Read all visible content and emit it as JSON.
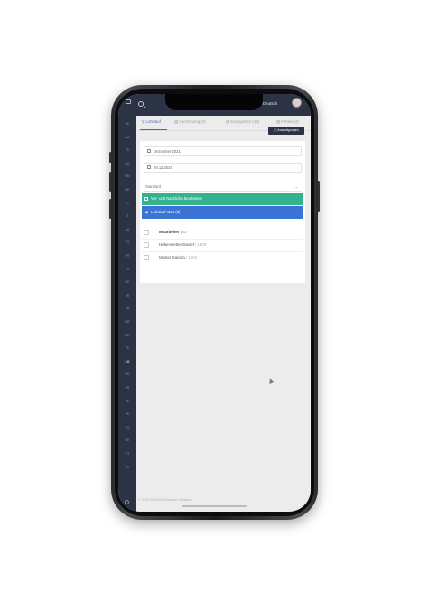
{
  "topbar": {
    "language": "Deutsch",
    "icons": [
      "logo-icon",
      "search-icon",
      "avatar"
    ]
  },
  "sidebar": {
    "items": [
      "DE",
      "MA",
      "TE",
      "KO",
      "UM",
      "NE",
      "VI",
      "IT",
      "AU",
      "FO",
      "PR",
      "FR",
      "RE",
      "ZR",
      "ZA",
      "WE",
      "BO",
      "FE",
      "LO",
      "DO",
      "PR",
      "ZE",
      "PE",
      "FO",
      "RE",
      "ST",
      "VI"
    ],
    "active_index": 18
  },
  "tabs": [
    {
      "label": "Lohnlauf",
      "active": true
    },
    {
      "label": "Abrechnung (3)"
    },
    {
      "label": "Eingegeben (18)"
    },
    {
      "label": "Fehlen (4)"
    }
  ],
  "toolbar": {
    "auspraegungen_label": "Ausprägungen"
  },
  "form": {
    "period": "Dezember 2021",
    "date": "29.12.2021",
    "select_value": "Standard"
  },
  "actions": {
    "edit_label": "Vor- und Nachlohn bearbeiten",
    "start_label": "Lohnlauf start (8)"
  },
  "employees": {
    "header": {
      "name": "Mitarbeiter",
      "suffix": " | ID"
    },
    "rows": [
      {
        "name": "Hubenstetter Daniel",
        "suffix": " | 1308"
      },
      {
        "name": "Muster Sandra",
        "suffix": " | 1004"
      }
    ]
  },
  "footer": {
    "text": "© 2020 ALCHIM Business Software"
  },
  "colors": {
    "sidebar": "#2b3344",
    "accent_green": "#33b38d",
    "accent_blue": "#3b74d4",
    "tab_active": "#4a6fb0"
  }
}
